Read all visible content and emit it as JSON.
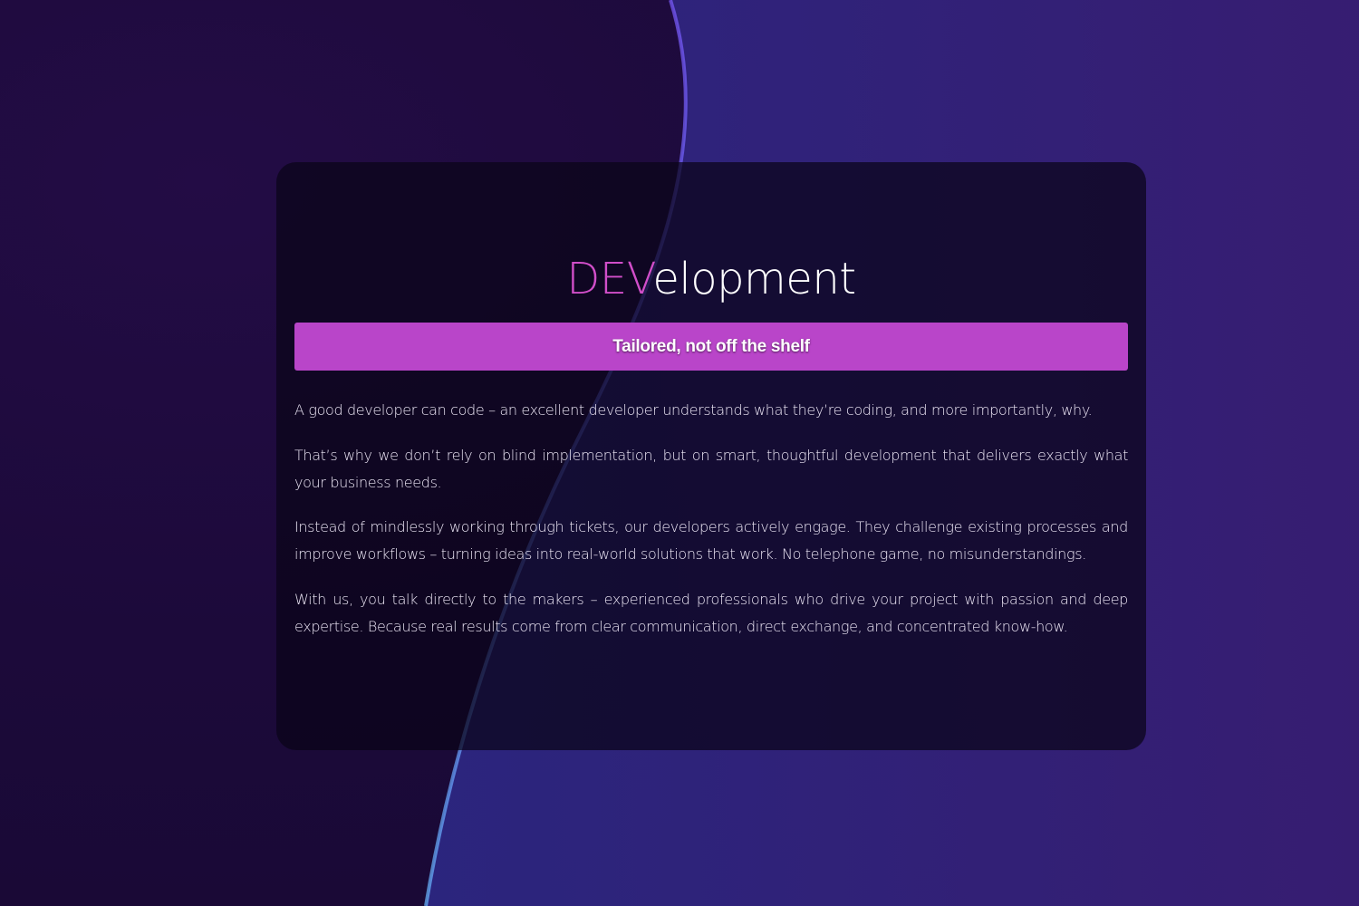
{
  "hero": {
    "title_accent": "DEV",
    "title_rest": "elopment",
    "banner_label": "Tailored, not off the shelf"
  },
  "content": {
    "paragraphs": [
      "A good developer can code – an excellent developer understands what they’re coding, and more importantly, why.",
      "That’s why we don’t rely on blind implementation, but on smart, thoughtful development that delivers exactly what your business needs.",
      "Instead of mindlessly working through tickets, our developers actively engage. They challenge existing processes and improve workflows – turning ideas into real-world solutions that work. No telephone game, no misunderstandings.",
      "With us, you talk directly to the makers – experienced professionals who drive your project with passion and deep expertise. Because real results come from clear communication, direct exchange, and concentrated know-how."
    ]
  },
  "colors": {
    "background": "#1d0b3b",
    "accent": "#d14ec9",
    "banner": "#b945c9",
    "card": "#0a0418"
  }
}
